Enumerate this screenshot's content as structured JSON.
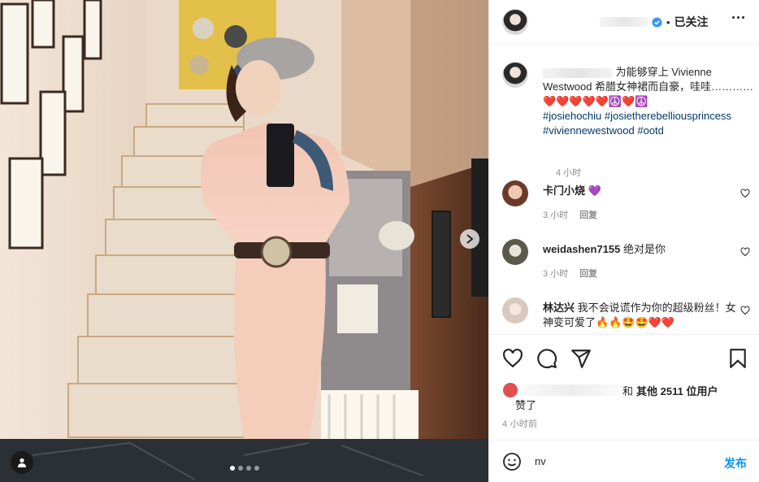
{
  "post": {
    "header": {
      "follow_status": "已关注",
      "separator": "•"
    },
    "caption": {
      "text_part1": "为能够穿上 Vivienne Westwood 希腊女神裙而自豪，哇哇…………",
      "emojis": "❤️❤️❤️❤️❤️☮️❤️☮️",
      "hashtags": [
        "#josiehochiu",
        "#josietherebelliousprincess",
        "#viviennewestwood",
        "#ootd"
      ],
      "time": "4 小时"
    },
    "comments": [
      {
        "username": "卡门小烧",
        "text": "💜",
        "time": "3 小时",
        "reply": "回复"
      },
      {
        "username": "weidashen7155",
        "text": "绝对是你",
        "time": "3 小时",
        "reply": "回复"
      },
      {
        "username": "林达兴",
        "text": "我不会说谎作为你的超级粉丝！女神变可爱了🔥🔥🤩🤩❤️❤️",
        "time": "",
        "reply": ""
      }
    ],
    "likes": {
      "and_word": "和",
      "others": "其他 2511 位用户",
      "line2": "赞了"
    },
    "post_time": "4 小时前",
    "composer": {
      "value": "nv",
      "post_label": "发布"
    },
    "carousel": {
      "slide_count": 4,
      "active_index": 0
    }
  },
  "icons": [
    "more-icon",
    "verified-icon",
    "heart-icon",
    "comment-icon",
    "share-icon",
    "bookmark-icon",
    "emoji-icon",
    "chevron-right-icon",
    "user-tag-icon"
  ],
  "colors": {
    "link": "#00376b",
    "accent": "#0095f6",
    "muted": "#8e8e8e",
    "verified": "#3897f0"
  }
}
